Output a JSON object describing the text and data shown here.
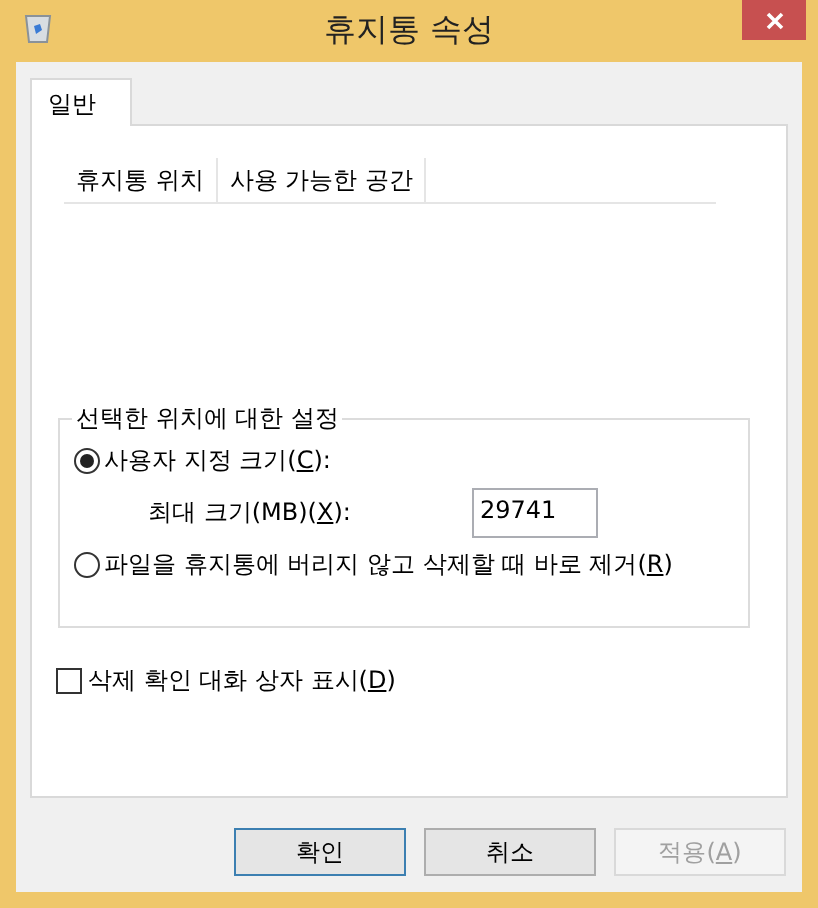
{
  "window": {
    "title": "휴지통 속성"
  },
  "tabs": [
    {
      "label": "일반",
      "selected": true
    }
  ],
  "list": {
    "columns": [
      "휴지통 위치",
      "사용 가능한 공간"
    ]
  },
  "settings": {
    "title": "선택한 위치에 대한 설정",
    "options": [
      {
        "before": "사용자 지정 크기(",
        "key": "C",
        "after": "):",
        "selected": true
      },
      {
        "before": "파일을 휴지통에 버리지 않고 삭제할 때 바로 제거(",
        "key": "R",
        "after": ")",
        "selected": false
      }
    ],
    "max_size": {
      "before": "최대 크기(MB)(",
      "key": "X",
      "after": "):",
      "value": "29741"
    }
  },
  "confirm": {
    "before": "삭제 확인 대화 상자 표시(",
    "key": "D",
    "after": ")",
    "checked": false
  },
  "buttons": [
    {
      "before": "확인",
      "kind": "default",
      "disabled": false
    },
    {
      "before": "취소",
      "kind": "normal",
      "disabled": false
    },
    {
      "before": "적용(",
      "key": "A",
      "after": ")",
      "kind": "normal",
      "disabled": true
    }
  ]
}
